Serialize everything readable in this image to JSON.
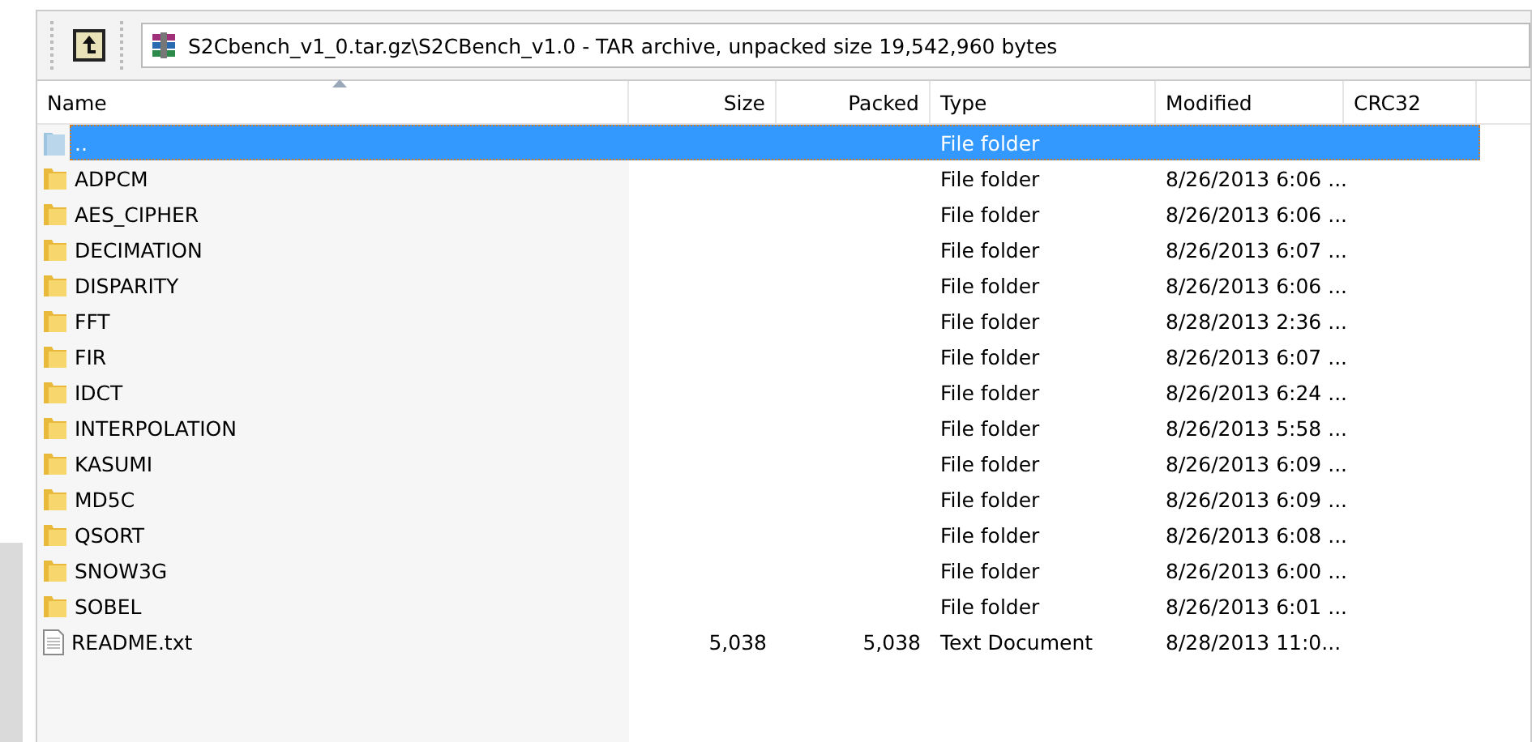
{
  "toolbar": {
    "address": "S2Cbench_v1_0.tar.gz\\S2CBench_v1.0 - TAR archive, unpacked size 19,542,960 bytes"
  },
  "table": {
    "columns": [
      {
        "label": "Name",
        "sorted": true
      },
      {
        "label": "Size",
        "sorted": false
      },
      {
        "label": "Packed",
        "sorted": false
      },
      {
        "label": "Type",
        "sorted": false
      },
      {
        "label": "Modified",
        "sorted": false
      },
      {
        "label": "CRC32",
        "sorted": false
      }
    ],
    "rows": [
      {
        "kind": "parent",
        "name": "..",
        "type": "File folder",
        "selected": true
      },
      {
        "kind": "folder",
        "name": "ADPCM",
        "type": "File folder",
        "modified": "8/26/2013 6:06 ...",
        "selected": false
      },
      {
        "kind": "folder",
        "name": "AES_CIPHER",
        "type": "File folder",
        "modified": "8/26/2013 6:06 ...",
        "selected": false
      },
      {
        "kind": "folder",
        "name": "DECIMATION",
        "type": "File folder",
        "modified": "8/26/2013 6:07 ...",
        "selected": false
      },
      {
        "kind": "folder",
        "name": "DISPARITY",
        "type": "File folder",
        "modified": "8/26/2013 6:06 ...",
        "selected": false
      },
      {
        "kind": "folder",
        "name": "FFT",
        "type": "File folder",
        "modified": "8/28/2013 2:36 ...",
        "selected": false
      },
      {
        "kind": "folder",
        "name": "FIR",
        "type": "File folder",
        "modified": "8/26/2013 6:07 ...",
        "selected": false
      },
      {
        "kind": "folder",
        "name": "IDCT",
        "type": "File folder",
        "modified": "8/26/2013 6:24 ...",
        "selected": false
      },
      {
        "kind": "folder",
        "name": "INTERPOLATION",
        "type": "File folder",
        "modified": "8/26/2013 5:58 ...",
        "selected": false
      },
      {
        "kind": "folder",
        "name": "KASUMI",
        "type": "File folder",
        "modified": "8/26/2013 6:09 ...",
        "selected": false
      },
      {
        "kind": "folder",
        "name": "MD5C",
        "type": "File folder",
        "modified": "8/26/2013 6:09 ...",
        "selected": false
      },
      {
        "kind": "folder",
        "name": "QSORT",
        "type": "File folder",
        "modified": "8/26/2013 6:08 ...",
        "selected": false
      },
      {
        "kind": "folder",
        "name": "SNOW3G",
        "type": "File folder",
        "modified": "8/26/2013 6:00 ...",
        "selected": false
      },
      {
        "kind": "folder",
        "name": "SOBEL",
        "type": "File folder",
        "modified": "8/26/2013 6:01 ...",
        "selected": false
      },
      {
        "kind": "file",
        "name": "README.txt",
        "size": "5,038",
        "packed": "5,038",
        "type": "Text Document",
        "modified": "8/28/2013 11:0...",
        "selected": false
      }
    ]
  }
}
